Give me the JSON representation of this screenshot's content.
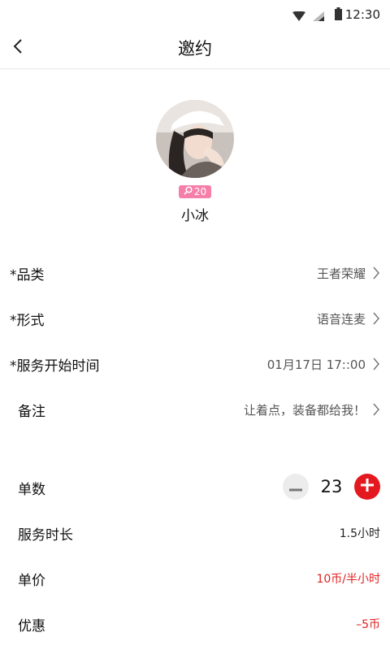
{
  "status_bar": {
    "time": "12:30"
  },
  "nav": {
    "title": "邀约"
  },
  "profile": {
    "badge_count": "20",
    "nickname": "小冰"
  },
  "form": {
    "category_label": "*品类",
    "category_value": "王者荣耀",
    "format_label": "*形式",
    "format_value": "语音连麦",
    "start_time_label": "*服务开始时间",
    "start_time_value": "01月17日 17::00",
    "remark_label": "备注",
    "remark_value": "让着点，装备都给我！"
  },
  "order": {
    "quantity_label": "单数",
    "quantity_value": "23",
    "duration_label": "服务时长",
    "duration_value": "1.5小时",
    "price_label": "单价",
    "price_value": "10币/半小时",
    "discount_label": "优惠",
    "discount_value": "–5币"
  },
  "colors": {
    "accent_red": "#e4191f",
    "badge_pink": "#f57fa8"
  },
  "icons": [
    "back-arrow-icon",
    "wifi-icon",
    "signal-icon",
    "battery-icon",
    "search-icon",
    "chevron-right-icon",
    "minus-icon",
    "plus-icon"
  ]
}
